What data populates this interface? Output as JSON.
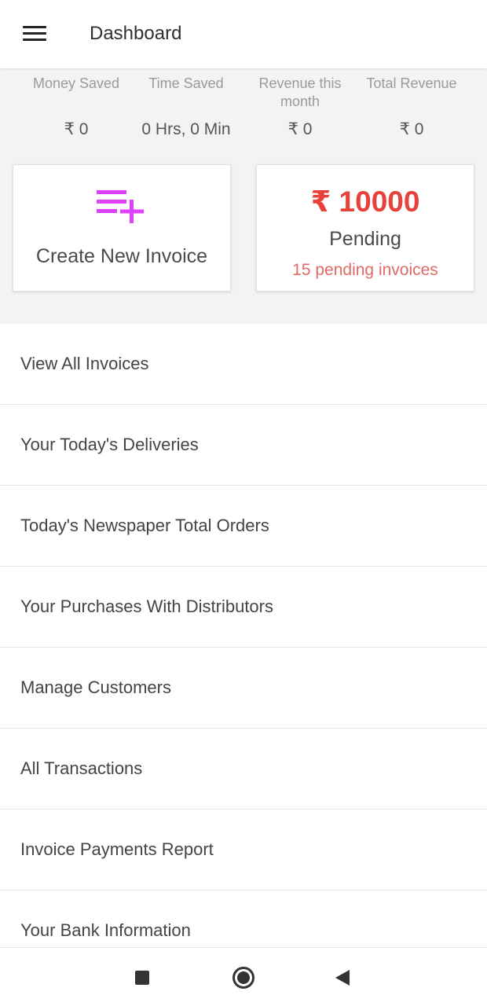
{
  "appbar": {
    "title": "Dashboard"
  },
  "stats": [
    {
      "label": "Money Saved",
      "value": "₹ 0"
    },
    {
      "label": "Time Saved",
      "value": "0 Hrs, 0 Min"
    },
    {
      "label": "Revenue this month",
      "value": "₹ 0"
    },
    {
      "label": "Total Revenue",
      "value": "₹ 0"
    }
  ],
  "create_card": {
    "label": "Create New Invoice",
    "icon": "playlist-add-icon"
  },
  "pending_card": {
    "amount": "₹ 10000",
    "label": "Pending",
    "count_text": "15 pending invoices"
  },
  "menu": [
    {
      "label": "View All Invoices"
    },
    {
      "label": "Your Today's Deliveries"
    },
    {
      "label": "Today's Newspaper Total Orders"
    },
    {
      "label": "Your Purchases With Distributors"
    },
    {
      "label": "Manage Customers"
    },
    {
      "label": "All Transactions"
    },
    {
      "label": "Invoice Payments Report"
    },
    {
      "label": "Your Bank Information"
    }
  ],
  "navbar": {
    "buttons": [
      "recents-icon",
      "home-icon",
      "back-icon"
    ]
  },
  "colors": {
    "accent_icon": "#e040fb",
    "pending_red": "#e8403a",
    "pending_light_red": "#e06b66",
    "summary_bg": "#f3f3f3"
  }
}
